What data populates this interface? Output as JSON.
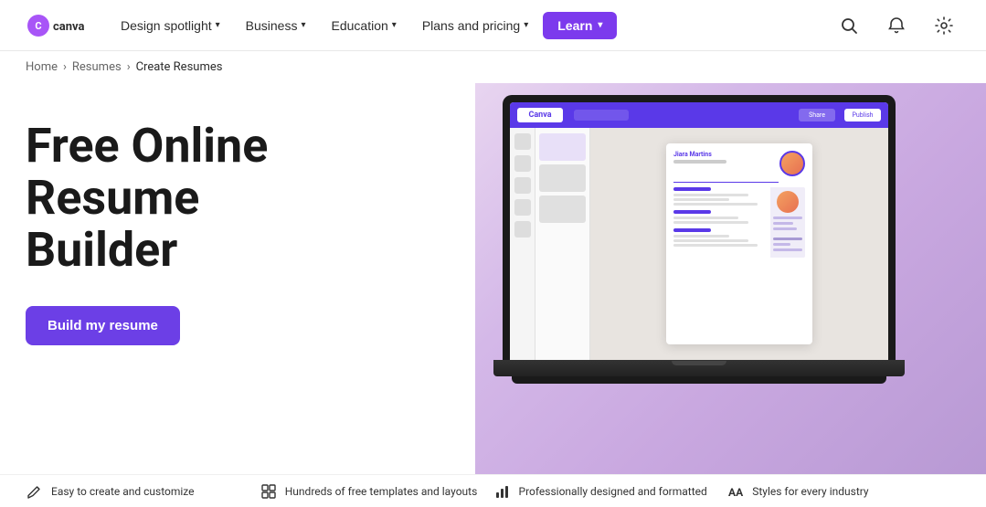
{
  "nav": {
    "logo_text": "canva",
    "items": [
      {
        "label": "Design spotlight",
        "has_chevron": true,
        "id": "design-spotlight"
      },
      {
        "label": "Business",
        "has_chevron": true,
        "id": "business"
      },
      {
        "label": "Education",
        "has_chevron": true,
        "id": "education"
      },
      {
        "label": "Plans and pricing",
        "has_chevron": true,
        "id": "plans-pricing"
      },
      {
        "label": "Learn",
        "has_chevron": true,
        "id": "learn"
      }
    ],
    "search_label": "🔍",
    "notifications_label": "🔔",
    "settings_label": "⚙"
  },
  "breadcrumb": {
    "home": "Home",
    "resumes": "Resumes",
    "current": "Create Resumes",
    "sep": "›"
  },
  "hero": {
    "title_line1": "Free Online Resume",
    "title_line2": "Builder",
    "cta_label": "Build my resume"
  },
  "features": [
    {
      "icon": "pencil-icon",
      "text": "Easy to create and customize"
    },
    {
      "icon": "grid-icon",
      "text": "Hundreds of free templates and layouts"
    },
    {
      "icon": "chart-icon",
      "text": "Professionally designed and formatted"
    },
    {
      "icon": "text-icon",
      "text": "Styles for every industry"
    }
  ],
  "editor": {
    "logo": "Canva",
    "share_btn": "Share",
    "publish_btn": "Publish"
  },
  "resume_preview": {
    "name": "Jiara Martins",
    "avatar_color1": "#f4a261",
    "avatar_color2": "#e76f51"
  }
}
